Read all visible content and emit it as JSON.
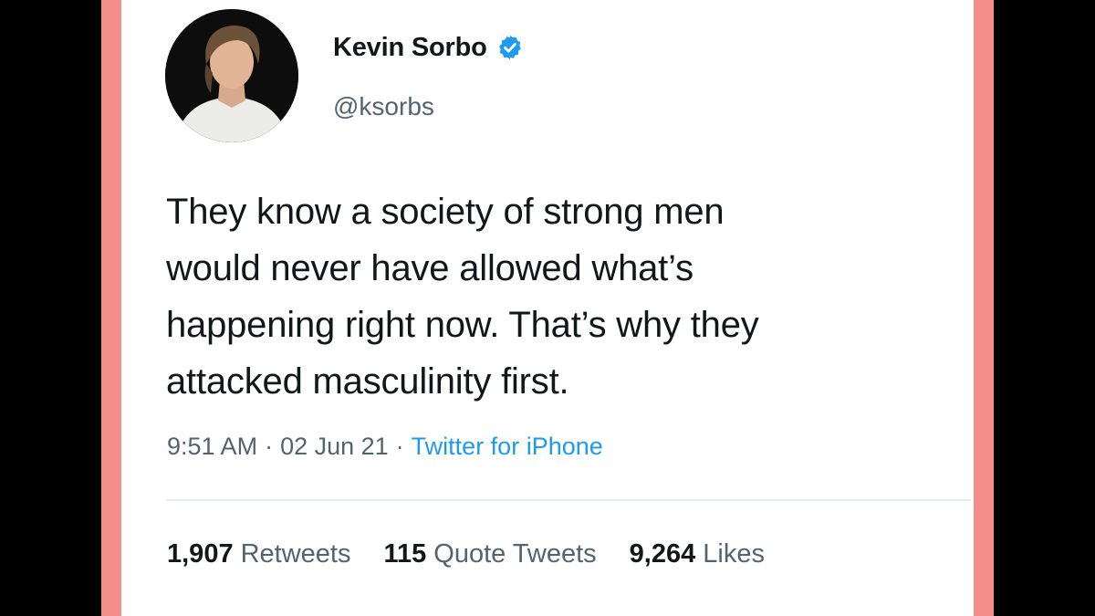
{
  "colors": {
    "frame": "#f38e8b",
    "text": "#14171a",
    "secondary": "#536471",
    "link": "#1d9bf0",
    "verified": "#1d9bf0"
  },
  "author": {
    "display_name": "Kevin Sorbo",
    "handle": "@ksorbs",
    "verified_icon": "verified-badge-icon"
  },
  "tweet": {
    "text": "They know a society of strong men\nwould never have allowed what’s\nhappening right now. That’s why they\nattacked masculinity first.",
    "time": "9:51 AM",
    "date": "02 Jun 21",
    "source": "Twitter for iPhone",
    "separator": "·"
  },
  "stats": {
    "retweets_count": "1,907",
    "retweets_label": "Retweets",
    "quotes_count": "115",
    "quotes_label": "Quote Tweets",
    "likes_count": "9,264",
    "likes_label": "Likes"
  }
}
